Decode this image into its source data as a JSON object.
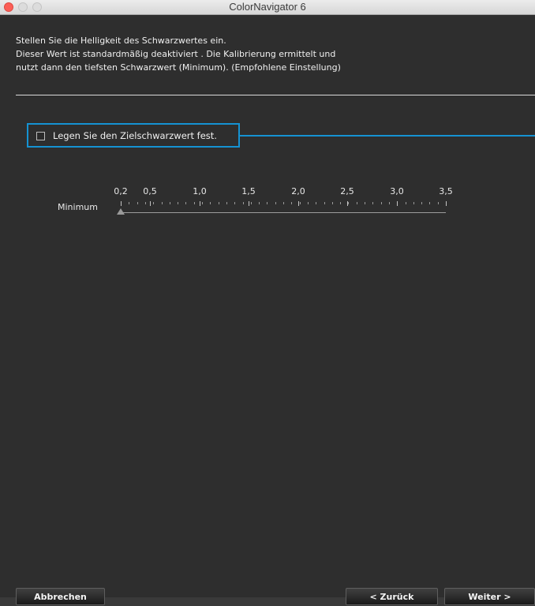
{
  "window": {
    "title": "ColorNavigator 6"
  },
  "description": {
    "line1": "Stellen Sie die Helligkeit des Schwarzwertes ein.",
    "line2": "Dieser Wert ist standardmäßig deaktiviert . Die Kalibrierung ermittelt und",
    "line3": "nutzt dann den tiefsten Schwarzwert (Minimum). (Empfohlene Einstellung)"
  },
  "checkbox": {
    "label": "Legen Sie den Zielschwarzwert fest.",
    "checked": false
  },
  "slider": {
    "label": "Minimum",
    "min": 0.2,
    "max": 3.5,
    "value": 0.2,
    "tick_labels": [
      "0,2",
      "0,5",
      "1,0",
      "1,5",
      "2,0",
      "2,5",
      "3,0",
      "3,5"
    ]
  },
  "buttons": {
    "cancel": "Abbrechen",
    "back": "< Zurück",
    "next": "Weiter >"
  },
  "colors": {
    "accent": "#1592d2",
    "background": "#2e2e2e",
    "close": "#fc5f57"
  }
}
